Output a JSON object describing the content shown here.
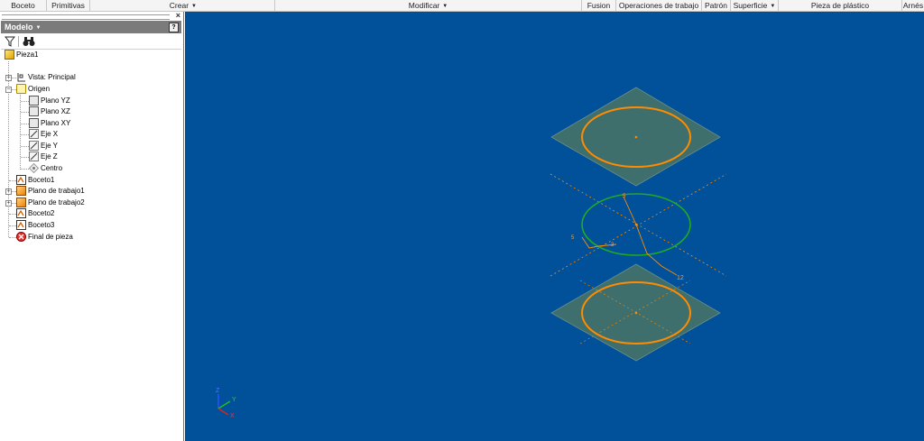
{
  "ribbon": {
    "tabs": [
      {
        "label": "Boceto",
        "dropdown": false
      },
      {
        "label": "Primitivas",
        "dropdown": false
      },
      {
        "label": "Crear",
        "dropdown": true
      },
      {
        "label": "Modificar",
        "dropdown": true
      },
      {
        "label": "Fusion",
        "dropdown": false
      },
      {
        "label": "Operaciones de trabajo",
        "dropdown": false
      },
      {
        "label": "Patrón",
        "dropdown": false
      },
      {
        "label": "Superficie",
        "dropdown": true
      },
      {
        "label": "Pieza de plástico",
        "dropdown": false
      },
      {
        "label": "Arnés",
        "dropdown": false
      }
    ]
  },
  "browser": {
    "title": "Modelo",
    "close_glyph": "×",
    "help_glyph": "?",
    "tree": [
      {
        "label": "Pieza1",
        "icon": "part-icon"
      },
      {
        "label": "Vista: Principal",
        "icon": "view-icon"
      },
      {
        "label": "Origen",
        "icon": "folder-icon"
      },
      {
        "label": "Plano YZ",
        "icon": "plane-icon"
      },
      {
        "label": "Plano XZ",
        "icon": "plane-icon"
      },
      {
        "label": "Plano XY",
        "icon": "plane-icon"
      },
      {
        "label": "Eje X",
        "icon": "axis-icon"
      },
      {
        "label": "Eje Y",
        "icon": "axis-icon"
      },
      {
        "label": "Eje Z",
        "icon": "axis-icon"
      },
      {
        "label": "Centro",
        "icon": "center-point-icon"
      },
      {
        "label": "Boceto1",
        "icon": "sketch-icon"
      },
      {
        "label": "Plano de trabajo1",
        "icon": "work-plane-icon"
      },
      {
        "label": "Plano de trabajo2",
        "icon": "work-plane-icon"
      },
      {
        "label": "Boceto2",
        "icon": "sketch-icon"
      },
      {
        "label": "Boceto3",
        "icon": "sketch-icon"
      },
      {
        "label": "Final de pieza",
        "icon": "end-of-part-icon"
      }
    ]
  },
  "viewport": {
    "dimensions": [
      "5",
      "3",
      "5",
      "12"
    ],
    "triad": {
      "x": "X",
      "y": "Y",
      "z": "Z"
    },
    "colors": {
      "background": "#00509a",
      "plane": "#3f6f6c",
      "sketch": "#ff8c00",
      "active_sketch": "#22aa22"
    }
  }
}
